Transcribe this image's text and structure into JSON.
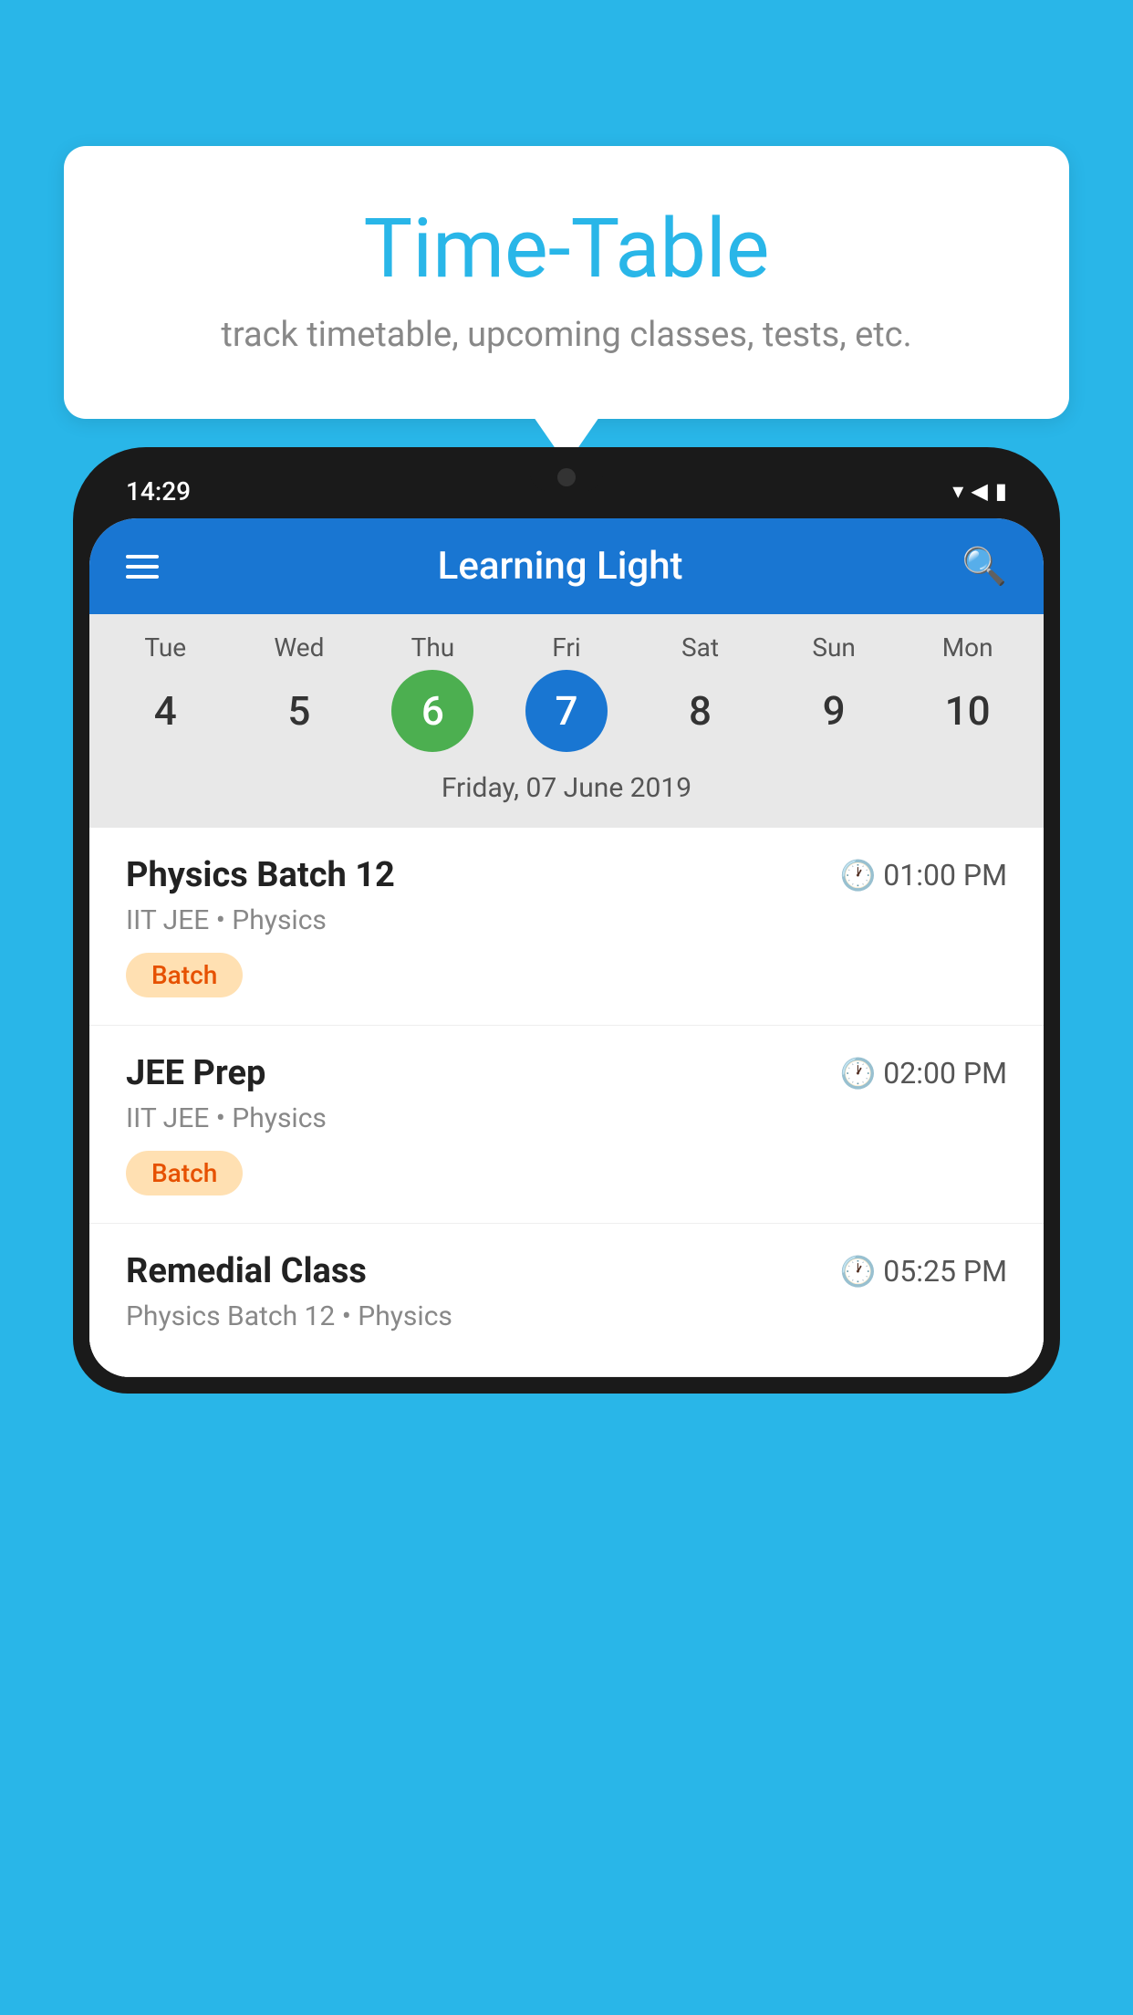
{
  "background_color": "#29B6E8",
  "speech_bubble": {
    "title": "Time-Table",
    "subtitle": "track timetable, upcoming classes, tests, etc."
  },
  "phone": {
    "status_bar": {
      "time": "14:29"
    },
    "app_bar": {
      "title": "Learning Light"
    },
    "calendar": {
      "days": [
        {
          "name": "Tue",
          "number": "4",
          "state": "normal"
        },
        {
          "name": "Wed",
          "number": "5",
          "state": "normal"
        },
        {
          "name": "Thu",
          "number": "6",
          "state": "today"
        },
        {
          "name": "Fri",
          "number": "7",
          "state": "selected"
        },
        {
          "name": "Sat",
          "number": "8",
          "state": "normal"
        },
        {
          "name": "Sun",
          "number": "9",
          "state": "normal"
        },
        {
          "name": "Mon",
          "number": "10",
          "state": "normal"
        }
      ],
      "selected_date_label": "Friday, 07 June 2019"
    },
    "schedule": [
      {
        "title": "Physics Batch 12",
        "time": "01:00 PM",
        "subtitle": "IIT JEE • Physics",
        "badge": "Batch"
      },
      {
        "title": "JEE Prep",
        "time": "02:00 PM",
        "subtitle": "IIT JEE • Physics",
        "badge": "Batch"
      },
      {
        "title": "Remedial Class",
        "time": "05:25 PM",
        "subtitle": "Physics Batch 12 • Physics",
        "badge": null
      }
    ]
  }
}
